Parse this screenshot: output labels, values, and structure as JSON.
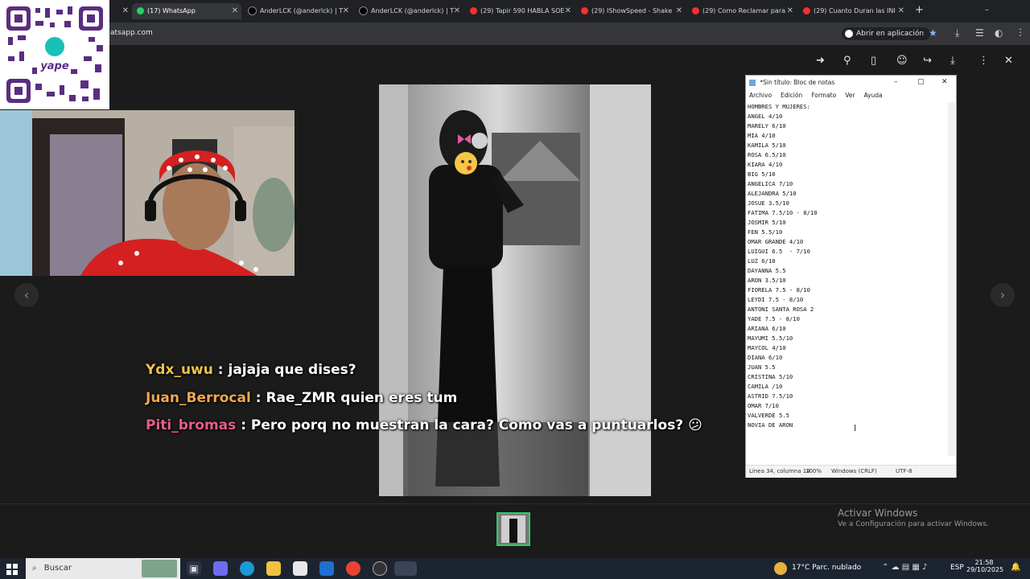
{
  "browser": {
    "tabs": [
      {
        "label": "",
        "color": "#555555"
      },
      {
        "label": "(17) WhatsApp",
        "color": "#25d366"
      },
      {
        "label": "AnderLCK (@anderlck) | T",
        "color": "#000000"
      },
      {
        "label": "AnderLCK (@anderlck) | T",
        "color": "#000000"
      },
      {
        "label": "(29) Tapir 590 HABLA SOE",
        "color": "#ff2d2d"
      },
      {
        "label": "(29) IShowSpeed - Shake",
        "color": "#ff2d2d"
      },
      {
        "label": "(29) Como Reclamar para",
        "color": "#ff2d2d"
      },
      {
        "label": "(29) Cuanto Duran las INI",
        "color": "#ff2d2d"
      }
    ],
    "new_tab": "+",
    "url": "atsapp.com",
    "open_in_app": "Abrir en aplicación",
    "window_controls": [
      "–",
      "⧉",
      "✕"
    ]
  },
  "qr": {
    "brand": "yape"
  },
  "chat": [
    {
      "user": "Ydx_uwu",
      "message": " : jajaja que dises?",
      "emoji": ""
    },
    {
      "user": "Juan_Berrocal",
      "message": " : Rae_ZMR quien eres tum",
      "emoji": ""
    },
    {
      "user": "Piti_bromas",
      "message": " : Pero porq no muestran la cara? Como vas a puntuarlos? ",
      "emoji": "😕"
    }
  ],
  "notepad": {
    "title": "*Sin título: Bloc de notas",
    "menu": [
      "Archivo",
      "Edición",
      "Formato",
      "Ver",
      "Ayuda"
    ],
    "lines": [
      "HOMBRES Y MUJERES:",
      "ANGEL 4/10",
      "MARELY 6/10",
      "MIA 4/10",
      "KAMILA 5/10",
      "ROSA 6.5/10",
      "KIARA 4/10",
      "BIG 5/10",
      "ANGELICA 7/10",
      "ALEJANDRA 5/10",
      "JOSUE 3.5/10",
      "FATIMA 7.5/10 - 8/10",
      "JOSMIR 5/10",
      "FEN 5.5/10",
      "OMAR GRANDE 4/10",
      "LUIGUI 6.5  - 7/10",
      "LUZ 6/10",
      "DAYANNA 5.5",
      "ARON 3.5/10",
      "FIORELA 7.5 - 8/10",
      "LEYDI 7.5 - 8/10",
      "ANTONI SANTA ROSA 2",
      "YADE 7.5 - 8/10",
      "ARIANA 6/10",
      "MAYUMI 5.5/10",
      "MAYCOL 4/10",
      "DIANA 6/10",
      "JUAN 5.5",
      "CRISTINA 5/10",
      "CAMILA /10",
      "ASTRID 7.5/10",
      "OMAR 7/10",
      "VALVERDE 5.5",
      "NOVIA DE ARON"
    ],
    "status": {
      "position": "Línea 34, columna 14",
      "zoom": "100%",
      "eol": "Windows (CRLF)",
      "encoding": "UTF-8"
    }
  },
  "activation": {
    "title": "Activar Windows",
    "subtitle": "Ve a Configuración para activar Windows."
  },
  "taskbar": {
    "search_placeholder": "Buscar",
    "weather": "17°C  Parc. nublado",
    "lang": "ESP",
    "time": "21:58",
    "date": "29/10/2025"
  }
}
